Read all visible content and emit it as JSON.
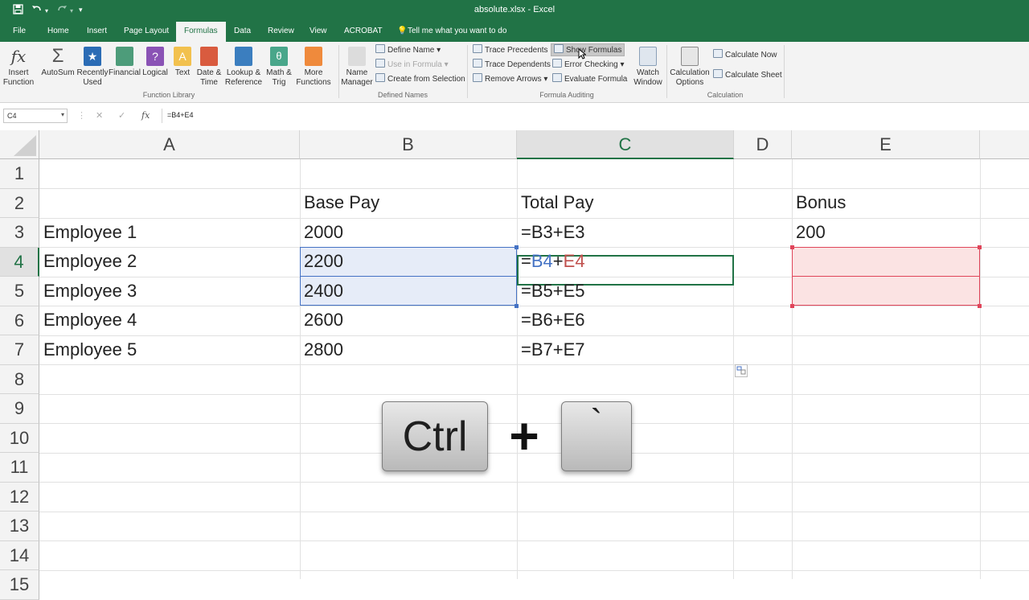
{
  "window": {
    "title": "absolute.xlsx  -  Excel"
  },
  "qat": {
    "save_icon": "save-icon",
    "undo_icon": "undo-icon",
    "redo_icon": "redo-icon",
    "customize_icon": "customize-icon"
  },
  "tabs": [
    {
      "label": "File"
    },
    {
      "label": "Home"
    },
    {
      "label": "Insert"
    },
    {
      "label": "Page Layout"
    },
    {
      "label": "Formulas"
    },
    {
      "label": "Data"
    },
    {
      "label": "Review"
    },
    {
      "label": "View"
    },
    {
      "label": "ACROBAT"
    },
    {
      "label": "Tell me what you want to do"
    }
  ],
  "ribbon": {
    "function_library": {
      "group_label": "Function Library",
      "insert_function": "Insert Function",
      "autosum": "AutoSum",
      "recently_used": "Recently Used",
      "financial": "Financial",
      "logical": "Logical",
      "text": "Text",
      "date_time": "Date & Time",
      "lookup_reference": "Lookup & Reference",
      "math_trig": "Math & Trig",
      "more_functions": "More Functions"
    },
    "defined_names": {
      "group_label": "Defined Names",
      "name_manager": "Name Manager",
      "define_name": "Define Name",
      "use_in_formula": "Use in Formula",
      "create_from_selection": "Create from Selection"
    },
    "formula_auditing": {
      "group_label": "Formula Auditing",
      "trace_precedents": "Trace Precedents",
      "trace_dependents": "Trace Dependents",
      "remove_arrows": "Remove Arrows",
      "show_formulas": "Show Formulas",
      "error_checking": "Error Checking",
      "evaluate_formula": "Evaluate Formula",
      "watch_window": "Watch Window"
    },
    "calculation": {
      "group_label": "Calculation",
      "calculation_options": "Calculation Options",
      "calculate_now": "Calculate Now",
      "calculate_sheet": "Calculate Sheet"
    }
  },
  "formula_bar": {
    "name_box": "C4",
    "formula": "=B4+E4"
  },
  "columns": [
    "A",
    "B",
    "C",
    "D",
    "E"
  ],
  "rows": [
    "1",
    "2",
    "3",
    "4",
    "5",
    "6",
    "7",
    "8",
    "9",
    "10",
    "11",
    "12",
    "13",
    "14",
    "15"
  ],
  "cells": {
    "B2": "Base Pay",
    "C2": "Total Pay",
    "E2": "Bonus",
    "A3": "Employee 1",
    "B3": "2000",
    "C3": "=B3+E3",
    "E3": "200",
    "A4": "Employee 2",
    "B4": "2200",
    "C4_eq": "=",
    "C4_ref1": "B4",
    "C4_plus": "+",
    "C4_ref2": "E4",
    "A5": "Employee 3",
    "B5": "2400",
    "C5": "=B5+E5",
    "A6": "Employee 4",
    "B6": "2600",
    "C6": "=B6+E6",
    "A7": "Employee 5",
    "B7": "2800",
    "C7": "=B7+E7"
  },
  "overlay": {
    "key1": "Ctrl",
    "plus": "+",
    "key2": "`"
  },
  "colors": {
    "excel_green": "#217346",
    "ref_blue": "#4472c4",
    "ref_red": "#c0504d"
  }
}
